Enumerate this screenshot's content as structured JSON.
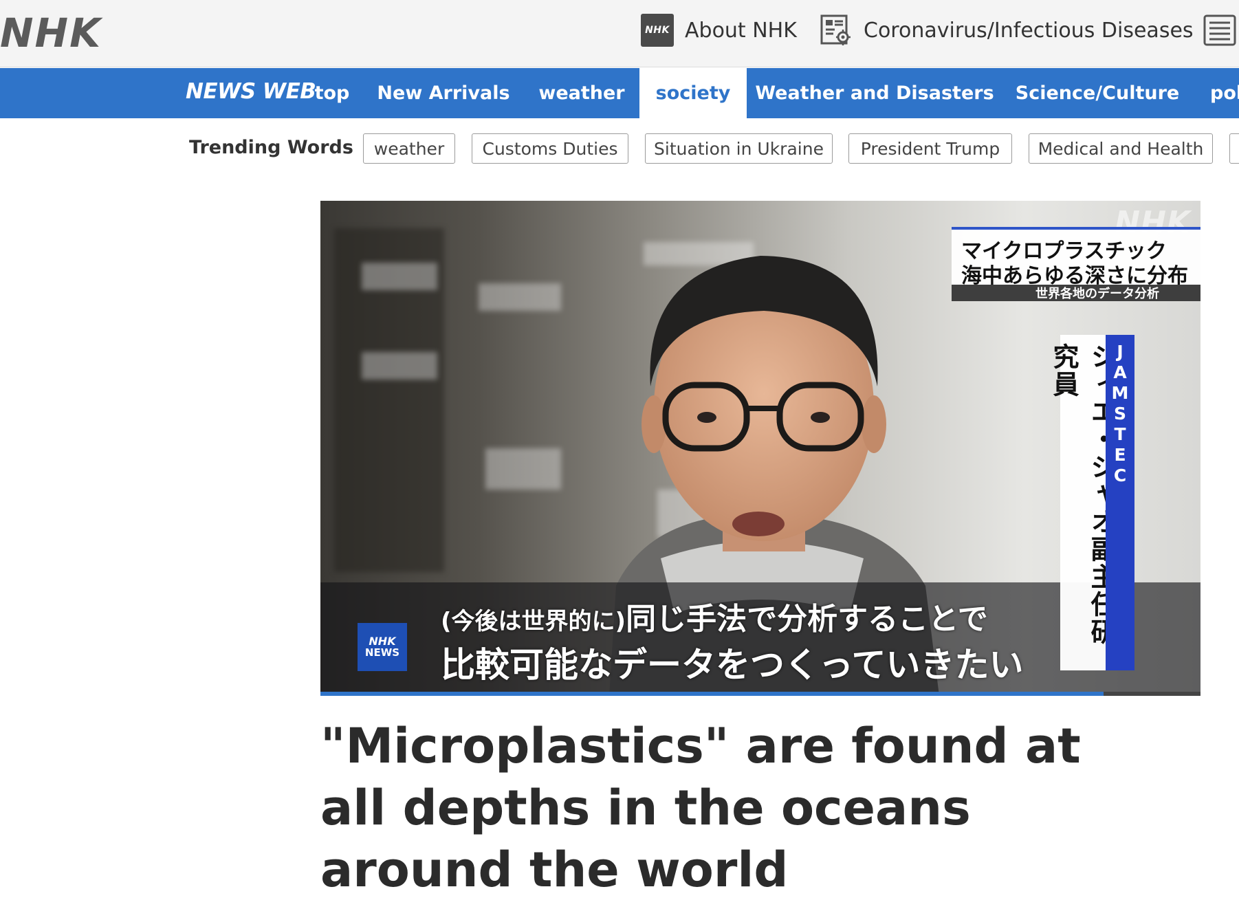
{
  "header": {
    "logo": "NHK",
    "links": [
      {
        "label": "About NHK",
        "icon": "nhk-square-icon",
        "badge": "NHK"
      },
      {
        "label": "Coronavirus/Infectious Diseases",
        "icon": "virus-info-icon"
      }
    ],
    "menu_icon": "list-menu-icon"
  },
  "nav": {
    "brand": "NEWS WEB",
    "items": [
      {
        "label": "top"
      },
      {
        "label": "New Arrivals"
      },
      {
        "label": "weather"
      },
      {
        "label": "society",
        "active": true
      },
      {
        "label": "Weather and Disasters"
      },
      {
        "label": "Science/Culture"
      },
      {
        "label": "pol"
      }
    ],
    "colors": {
      "bar": "#2f74c9",
      "active_bg": "#ffffff",
      "active_text": "#2f74c9"
    }
  },
  "trending": {
    "label": "Trending Words",
    "chips": [
      "weather",
      "Customs Duties",
      "Situation in Ukraine",
      "President Trump",
      "Medical and Health"
    ]
  },
  "video": {
    "watermark": "NHK",
    "title_line1": "マイクロプラスチック",
    "title_line2": "海中あらゆる深さに分布",
    "title_sub": "世界各地のデータ分析",
    "person_name": "シィエ・ジャオ副主任研究員",
    "organization": "JAMSTEC",
    "caption_paren": "(今後は世界的に)",
    "caption_line1": "同じ手法で分析することで",
    "caption_line2": "比較可能なデータをつくっていきたい",
    "badge_line1": "NHK",
    "badge_line2": "NEWS",
    "progress": 0.89
  },
  "article": {
    "headline": "\"Microplastics\" are found at all depths in the oceans around the world"
  }
}
